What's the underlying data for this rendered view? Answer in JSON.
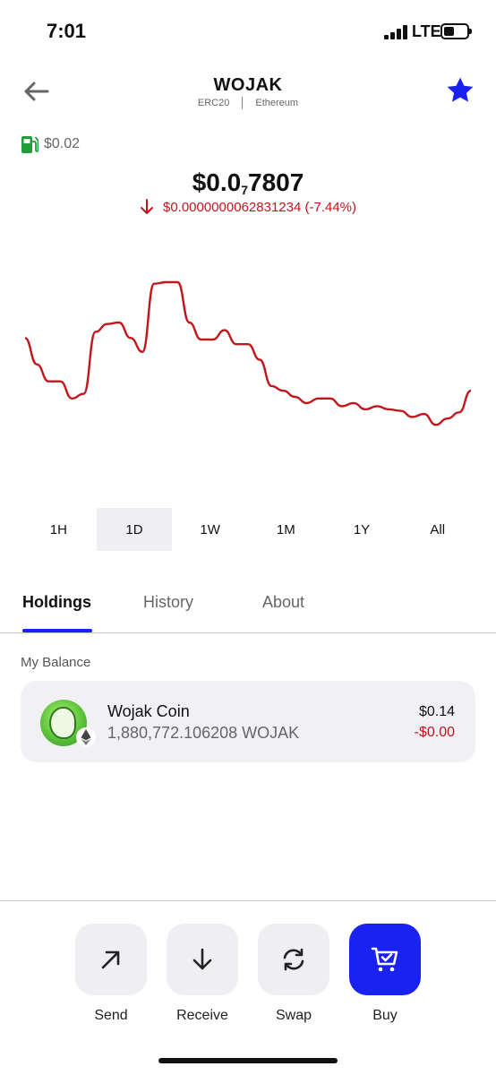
{
  "status_bar": {
    "time": "7:01",
    "network": "LTE",
    "battery_level": 0.45
  },
  "header": {
    "title": "WOJAK",
    "standard": "ERC20",
    "network": "Ethereum",
    "back_icon": "arrow-left-icon",
    "favorite_icon": "star-icon"
  },
  "gas": {
    "icon": "gas-pump-icon",
    "value": "$0.02"
  },
  "price": {
    "main": "$0.0",
    "zero_count": "7",
    "digits": "7807"
  },
  "change": {
    "icon": "arrow-down-icon",
    "text": "$0.0000000062831234 (-7.44%)"
  },
  "chart_data": {
    "type": "line",
    "series": [
      {
        "values": [
          0.64,
          0.47,
          0.36,
          0.36,
          0.25,
          0.28,
          0.68,
          0.73,
          0.74,
          0.64,
          0.55,
          0.99,
          1.0,
          1.0,
          0.74,
          0.63,
          0.63,
          0.69,
          0.6,
          0.6,
          0.5,
          0.33,
          0.3,
          0.26,
          0.22,
          0.25,
          0.25,
          0.2,
          0.22,
          0.18,
          0.2,
          0.18,
          0.17,
          0.13,
          0.15,
          0.08,
          0.12,
          0.16,
          0.3
        ]
      }
    ],
    "color": "#c0161c"
  },
  "time_ranges": [
    {
      "label": "1H",
      "active": false
    },
    {
      "label": "1D",
      "active": true
    },
    {
      "label": "1W",
      "active": false
    },
    {
      "label": "1M",
      "active": false
    },
    {
      "label": "1Y",
      "active": false
    },
    {
      "label": "All",
      "active": false
    }
  ],
  "tabs": [
    {
      "label": "Holdings",
      "active": true
    },
    {
      "label": "History",
      "active": false
    },
    {
      "label": "About",
      "active": false
    }
  ],
  "balance": {
    "section_label": "My Balance",
    "name": "Wojak Coin",
    "amount": "1,880,772.106208 WOJAK",
    "value": "$0.14",
    "change": "-$0.00",
    "badge_icon": "ethereum-icon"
  },
  "actions": [
    {
      "label": "Send",
      "icon": "arrow-up-right-icon"
    },
    {
      "label": "Receive",
      "icon": "arrow-down-icon"
    },
    {
      "label": "Swap",
      "icon": "swap-icon"
    },
    {
      "label": "Buy",
      "icon": "cart-icon"
    }
  ],
  "colors": {
    "accent": "#1a22f0",
    "negative": "#c0161c",
    "gas": "#1e9e3a",
    "surface": "#f1f1f5"
  }
}
